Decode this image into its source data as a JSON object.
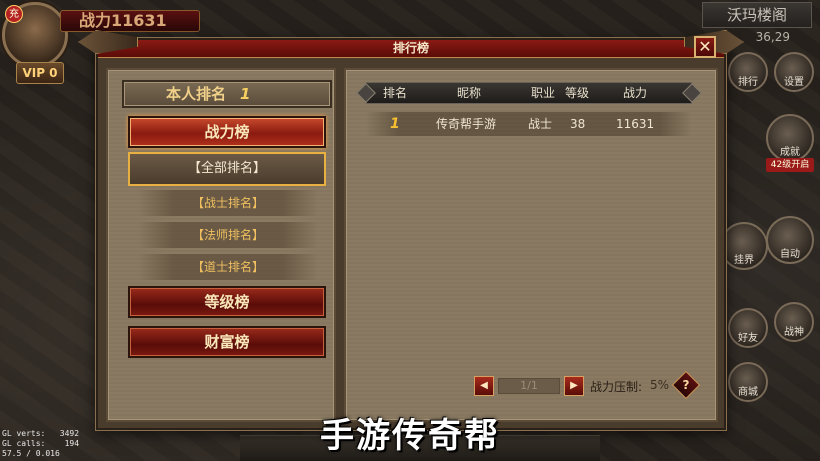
{
  "hud": {
    "avatar_badge": "充",
    "power": "战力11631",
    "vip": "VIP 0",
    "map_name": "沃玛楼阁",
    "coords": "36,29",
    "side_icons": [
      "排行",
      "设置",
      "成就",
      "挂界",
      "自动",
      "好友",
      "战神",
      "商城"
    ],
    "level_notice": "42级开启",
    "debug": "GL verts:   3492\nGL calls:    194\n57.5 / 0.016"
  },
  "dialog": {
    "title": "排行榜",
    "close": "✕",
    "self_rank_label": "本人排名",
    "self_rank_value": "1",
    "categories": {
      "power": "战力榜",
      "level": "等级榜",
      "wealth": "财富榜"
    },
    "subfilters": [
      "【全部排名】",
      "【战士排名】",
      "【法师排名】",
      "【道士排名】"
    ],
    "table": {
      "headers": [
        "排名",
        "昵称",
        "职业",
        "等级",
        "战力"
      ],
      "rows": [
        {
          "rank": "1",
          "name": "传奇帮手游",
          "class": "战士",
          "level": "38",
          "power": "11631"
        }
      ]
    },
    "pager": {
      "prev": "◀",
      "next": "▶",
      "page": "1/1"
    },
    "suppress_label": "战力压制:",
    "suppress_value": "5%",
    "help": "?"
  },
  "watermark": "手游传奇帮"
}
